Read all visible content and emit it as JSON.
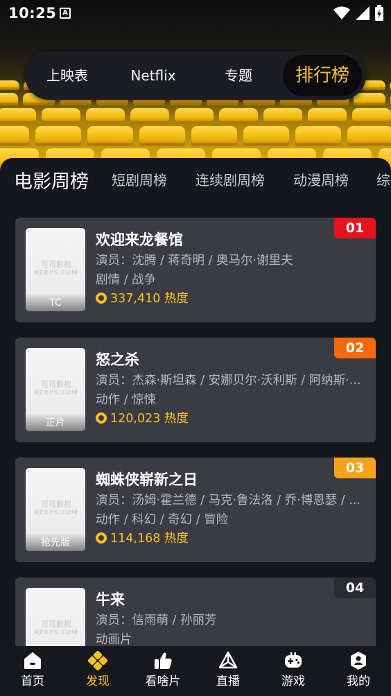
{
  "status_bar": {
    "time": "10:25",
    "notification_icon": "A"
  },
  "top_tabs": [
    {
      "label": "上映表",
      "active": false
    },
    {
      "label": "Netflix",
      "active": false
    },
    {
      "label": "专题",
      "active": false
    },
    {
      "label": "排行榜",
      "active": true
    }
  ],
  "category_tabs": [
    {
      "label": "电影周榜",
      "active": true
    },
    {
      "label": "短剧周榜",
      "active": false
    },
    {
      "label": "连续剧周榜",
      "active": false
    },
    {
      "label": "动漫周榜",
      "active": false
    },
    {
      "label": "综",
      "active": false
    }
  ],
  "rankings": [
    {
      "rank": "01",
      "rank_color": "#e8131c",
      "title": "欢迎来龙餐馆",
      "actors": "演员：沈腾 / 蒋奇明 / 奥马尔·谢里夫",
      "genres": "剧情 / 战争",
      "heat": "337,410 热度",
      "tag": "TC",
      "watermark_logo": "可可影视",
      "watermark_site": "KEKYS.COM"
    },
    {
      "rank": "02",
      "rank_color": "#f26a0c",
      "title": "怒之杀",
      "actors": "演员：杰森·斯坦森 / 安娜贝尔·沃利斯 / 阿纳斯·...",
      "genres": "动作 / 惊悚",
      "heat": "120,023 热度",
      "tag": "正片",
      "watermark_logo": "可可影视",
      "watermark_site": "KEKYS.COM"
    },
    {
      "rank": "03",
      "rank_color": "#f7a21a",
      "title": "蜘蛛侠崭新之日",
      "actors": "演员：汤姆·霍兰德 / 马克·鲁法洛 / 乔·博恩瑟 / ...",
      "genres": "动作 / 科幻 / 奇幻 / 冒险",
      "heat": "114,168 热度",
      "tag": "抢先版",
      "watermark_logo": "可可影视",
      "watermark_site": "KEKYS.COM"
    },
    {
      "rank": "04",
      "rank_color": "#2a2b31",
      "title": "牛来",
      "actors": "演员：信雨萌 / 孙丽芳",
      "genres": "动画片",
      "heat": "",
      "tag": "",
      "watermark_logo": "可可影视",
      "watermark_site": "KEKYS.COM"
    }
  ],
  "bottom_nav": [
    {
      "label": "首页",
      "icon": "home-icon",
      "active": false
    },
    {
      "label": "发现",
      "icon": "discover-icon",
      "active": true
    },
    {
      "label": "看啥片",
      "icon": "thumbs-up-icon",
      "active": false
    },
    {
      "label": "直播",
      "icon": "live-icon",
      "active": false
    },
    {
      "label": "游戏",
      "icon": "gamepad-icon",
      "active": false
    },
    {
      "label": "我的",
      "icon": "profile-icon",
      "active": false
    }
  ],
  "colors": {
    "accent": "#f7c221",
    "background": "#16171c",
    "card": "#3a3b43"
  }
}
